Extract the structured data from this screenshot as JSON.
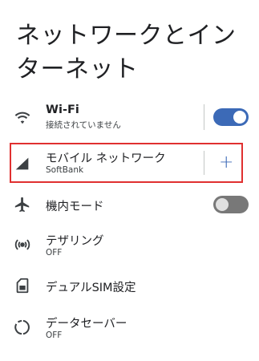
{
  "page_title": "ネットワークとインターネット",
  "rows": [
    {
      "title": "Wi-Fi",
      "subtitle": "接続されていません",
      "icon": "wifi-icon",
      "toggle": "on"
    },
    {
      "title": "モバイル ネットワーク",
      "subtitle": "SoftBank",
      "icon": "signal-icon",
      "action": "+"
    },
    {
      "title": "機内モード",
      "icon": "airplane-icon",
      "toggle": "off"
    },
    {
      "title": "テザリング",
      "subtitle": "OFF",
      "icon": "hotspot-icon"
    },
    {
      "title": "デュアルSIM設定",
      "icon": "sim-card-icon"
    },
    {
      "title": "データセーバー",
      "subtitle": "OFF",
      "icon": "data-saver-icon"
    }
  ],
  "colors": {
    "accent": "#3c6ab7",
    "highlight_border": "#e03030",
    "toggle_off": "#787878"
  }
}
